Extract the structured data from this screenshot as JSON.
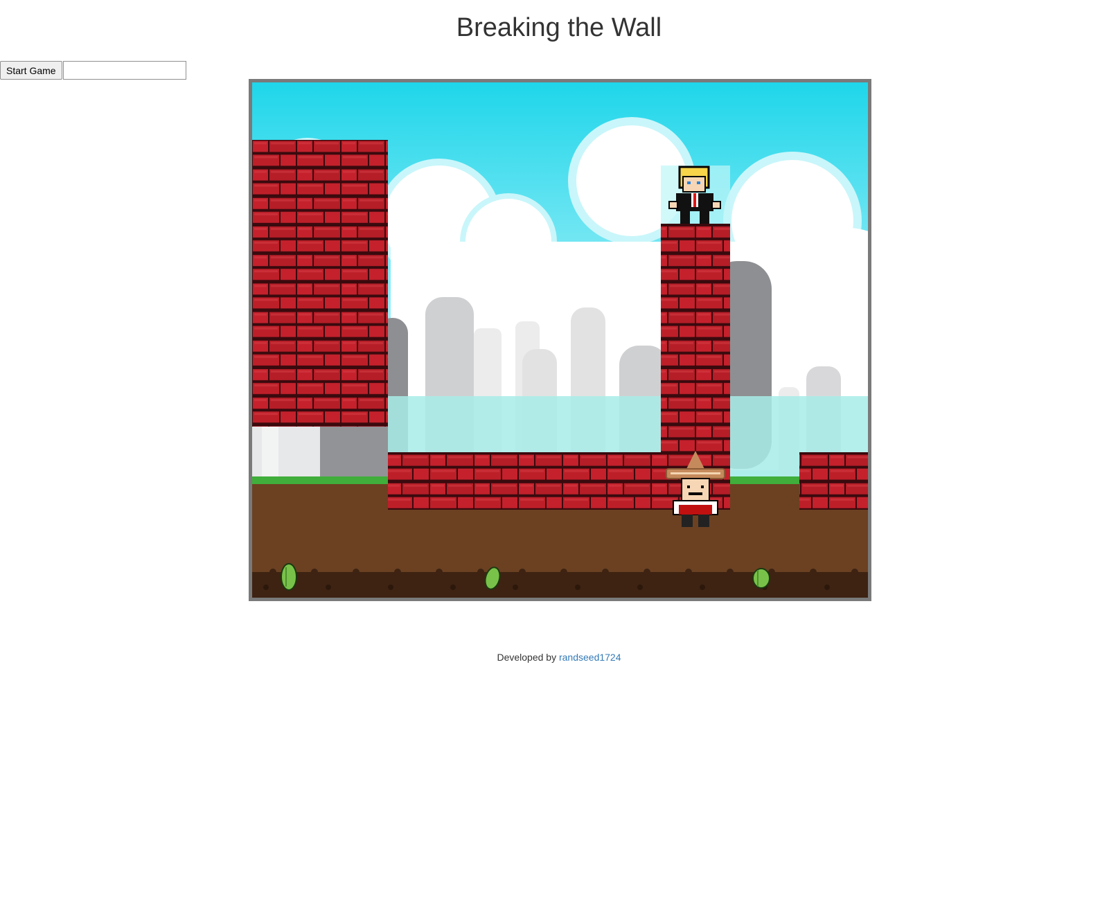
{
  "page": {
    "title": "Breaking the Wall"
  },
  "controls": {
    "start_label": "Start Game",
    "text_value": "",
    "text_placeholder": ""
  },
  "footer": {
    "prefix": "Developed by",
    "author": "randseed1724"
  },
  "game": {
    "characters": [
      "blonde-man-in-suit",
      "man-in-sombrero"
    ],
    "props": [
      "cactus",
      "cactus",
      "cactus"
    ],
    "colors": {
      "sky": "#7ee4f2",
      "brick": "#c0202a",
      "mortar": "#3a0a0e",
      "grass": "#3fae3a",
      "dirt": "#6b4122",
      "water": "#a8ece8"
    }
  }
}
